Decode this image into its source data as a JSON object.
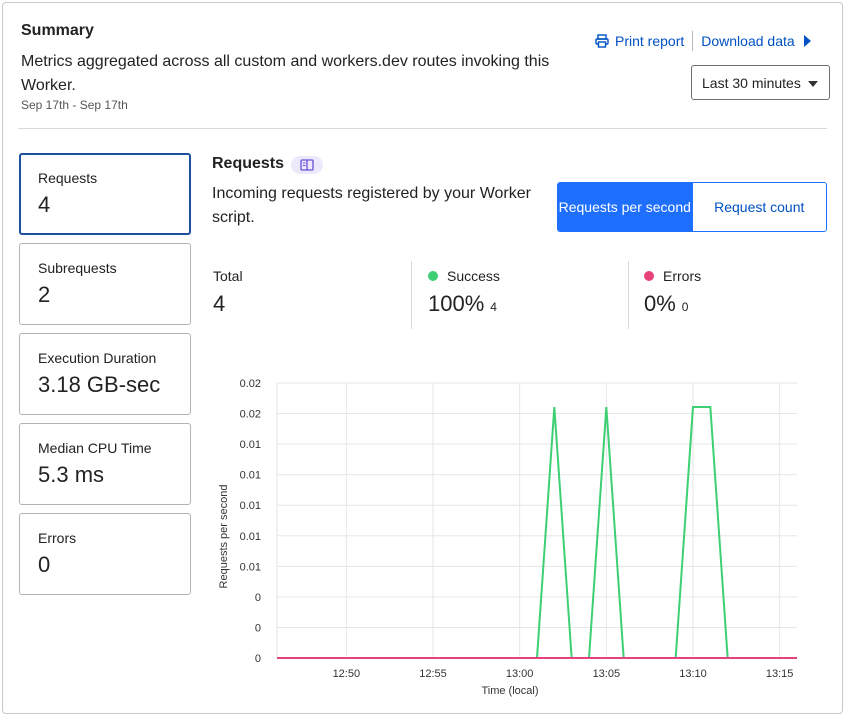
{
  "summary": {
    "title": "Summary",
    "description": "Metrics aggregated across all custom and workers.dev routes invoking this Worker.",
    "date_range": "Sep 17th - Sep 17th"
  },
  "actions": {
    "print_label": "Print report",
    "download_label": "Download data",
    "time_range": "Last 30 minutes"
  },
  "metrics": [
    {
      "label": "Requests",
      "value": "4"
    },
    {
      "label": "Subrequests",
      "value": "2"
    },
    {
      "label": "Execution Duration",
      "value": "3.18 GB-sec"
    },
    {
      "label": "Median CPU Time",
      "value": "5.3 ms"
    },
    {
      "label": "Errors",
      "value": "0"
    }
  ],
  "requests_panel": {
    "title": "Requests",
    "description": "Incoming requests registered by your Worker script.",
    "toggle": {
      "per_second": "Requests per second",
      "count": "Request count"
    },
    "stats": {
      "total_label": "Total",
      "total_value": "4",
      "success_label": "Success",
      "success_value": "100%",
      "success_count": "4",
      "errors_label": "Errors",
      "errors_value": "0%",
      "errors_count": "0"
    }
  },
  "colors": {
    "accent": "#1f6fff",
    "link": "#0051c3",
    "success": "#3ecf74",
    "error": "#e8407a",
    "active_card_border": "#1e4e9c"
  },
  "chart_data": {
    "type": "line",
    "xlabel": "Time (local)",
    "ylabel": "Requests per second",
    "x_ticks": [
      "12:50",
      "12:55",
      "13:00",
      "13:05",
      "13:10",
      "13:15"
    ],
    "y_ticks": [
      "0",
      "0",
      "0",
      "0.01",
      "0.01",
      "0.01",
      "0.01",
      "0.01",
      "0.02",
      "0.02"
    ],
    "xlim": [
      "12:46",
      "13:16"
    ],
    "ylim": [
      0,
      0.0183
    ],
    "grid": true,
    "series": [
      {
        "name": "Success",
        "color": "#3ecf74",
        "points": [
          [
            "12:46",
            0
          ],
          [
            "13:01",
            0
          ],
          [
            "13:02",
            0.0167
          ],
          [
            "13:03",
            0
          ],
          [
            "13:04",
            0
          ],
          [
            "13:05",
            0.0167
          ],
          [
            "13:06",
            0
          ],
          [
            "13:09",
            0
          ],
          [
            "13:10",
            0.0167
          ],
          [
            "13:11",
            0.0167
          ],
          [
            "13:12",
            0
          ],
          [
            "13:16",
            0
          ]
        ]
      },
      {
        "name": "Errors",
        "color": "#e8407a",
        "points": [
          [
            "12:46",
            0
          ],
          [
            "13:16",
            0
          ]
        ]
      }
    ]
  }
}
